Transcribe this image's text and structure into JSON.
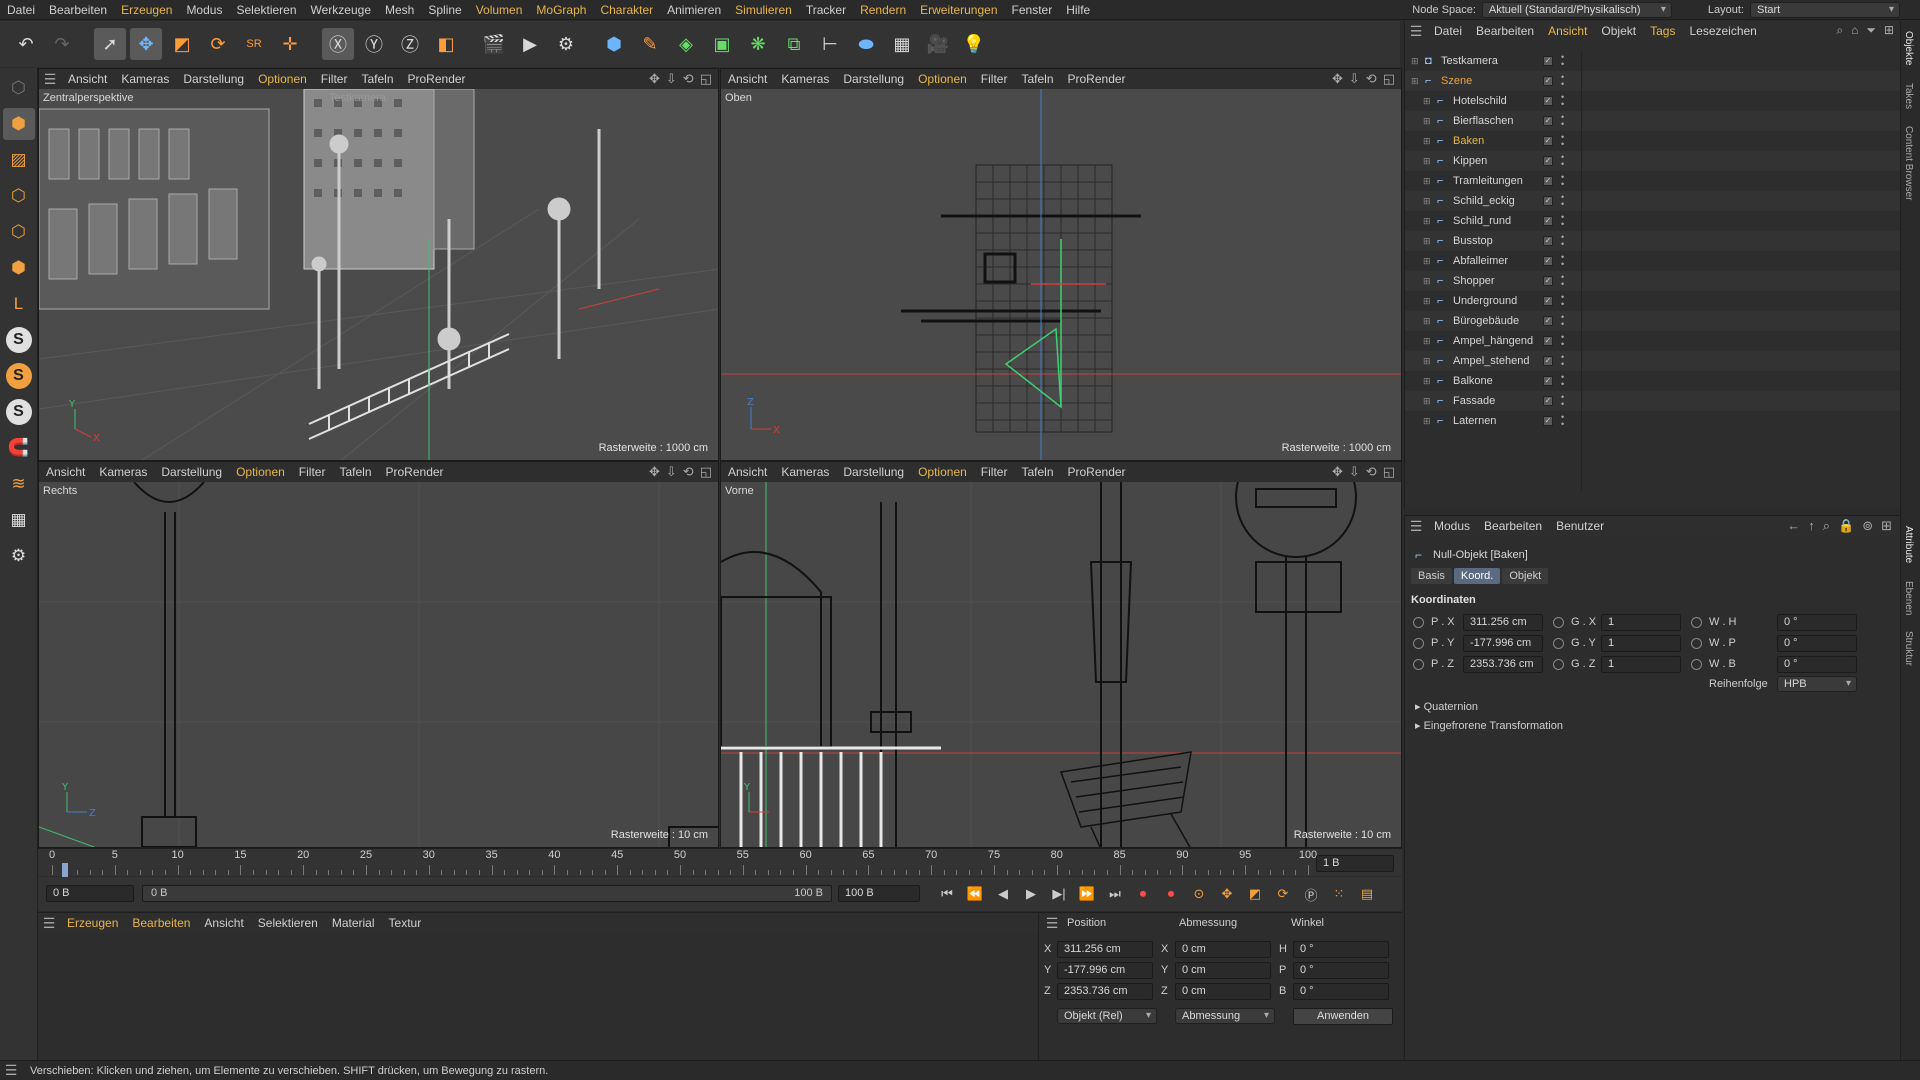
{
  "menubar": {
    "items": [
      "Datei",
      "Bearbeiten",
      "Erzeugen",
      "Modus",
      "Selektieren",
      "Werkzeuge",
      "Mesh",
      "Spline",
      "Volumen",
      "MoGraph",
      "Charakter",
      "Animieren",
      "Simulieren",
      "Tracker",
      "Rendern",
      "Erweiterungen",
      "Fenster",
      "Hilfe"
    ],
    "highlighted": [
      "Erzeugen",
      "Volumen",
      "MoGraph",
      "Charakter",
      "Simulieren",
      "Rendern",
      "Erweiterungen"
    ],
    "node_space_label": "Node Space:",
    "node_space_value": "Aktuell (Standard/Physikalisch)",
    "layout_label": "Layout:",
    "layout_value": "Start"
  },
  "viewports": {
    "menu": [
      "Ansicht",
      "Kameras",
      "Darstellung",
      "Optionen",
      "Filter",
      "Tafeln",
      "ProRender"
    ],
    "top_left": {
      "name": "Zentralperspektive",
      "camera": "Testkamera",
      "grid": "Rasterweite : 1000 cm"
    },
    "top_right": {
      "name": "Oben",
      "grid": "Rasterweite : 1000 cm"
    },
    "bottom_left": {
      "name": "Rechts",
      "grid": "Rasterweite : 10 cm"
    },
    "bottom_right": {
      "name": "Vorne",
      "grid": "Rasterweite : 10 cm"
    }
  },
  "timeline": {
    "ticks": [
      "0",
      "5",
      "10",
      "15",
      "20",
      "25",
      "30",
      "35",
      "40",
      "45",
      "50",
      "55",
      "60",
      "65",
      "70",
      "75",
      "80",
      "85",
      "90",
      "95",
      "100"
    ],
    "current_frame_field": "1 B",
    "start_field": "0 B",
    "range_start": "0 B",
    "range_end": "100 B",
    "end_field": "100 B"
  },
  "material_manager": {
    "menu": [
      "Erzeugen",
      "Bearbeiten",
      "Ansicht",
      "Selektieren",
      "Material",
      "Textur"
    ],
    "highlighted": [
      "Erzeugen",
      "Bearbeiten"
    ]
  },
  "coordinates": {
    "headers": {
      "position": "Position",
      "size": "Abmessung",
      "rotation": "Winkel"
    },
    "rows": [
      {
        "axis": "X",
        "pos": "311.256 cm",
        "size_axis": "X",
        "size": "0 cm",
        "rot_axis": "H",
        "rot": "0 °"
      },
      {
        "axis": "Y",
        "pos": "-177.996 cm",
        "size_axis": "Y",
        "size": "0 cm",
        "rot_axis": "P",
        "rot": "0 °"
      },
      {
        "axis": "Z",
        "pos": "2353.736 cm",
        "size_axis": "Z",
        "size": "0 cm",
        "rot_axis": "B",
        "rot": "0 °"
      }
    ],
    "mode": "Objekt (Rel)",
    "size_mode": "Abmessung",
    "apply": "Anwenden"
  },
  "status": "Verschieben: Klicken und ziehen, um Elemente zu verschieben. SHIFT drücken, um Bewegung zu rastern.",
  "object_manager": {
    "menu": [
      "Datei",
      "Bearbeiten",
      "Ansicht",
      "Objekt",
      "Tags",
      "Lesezeichen"
    ],
    "highlighted": [
      "Ansicht",
      "Tags"
    ],
    "objects": [
      {
        "name": "Testkamera",
        "level": 0,
        "type": "camera"
      },
      {
        "name": "Szene",
        "level": 0,
        "type": "null",
        "color": "orange"
      },
      {
        "name": "Hotelschild",
        "level": 1,
        "type": "null"
      },
      {
        "name": "Bierflaschen",
        "level": 1,
        "type": "null"
      },
      {
        "name": "Baken",
        "level": 1,
        "type": "null",
        "color": "selected"
      },
      {
        "name": "Kippen",
        "level": 1,
        "type": "null"
      },
      {
        "name": "Tramleitungen",
        "level": 1,
        "type": "null"
      },
      {
        "name": "Schild_eckig",
        "level": 1,
        "type": "null"
      },
      {
        "name": "Schild_rund",
        "level": 1,
        "type": "null"
      },
      {
        "name": "Busstop",
        "level": 1,
        "type": "null"
      },
      {
        "name": "Abfalleimer",
        "level": 1,
        "type": "null"
      },
      {
        "name": "Shopper",
        "level": 1,
        "type": "null"
      },
      {
        "name": "Underground",
        "level": 1,
        "type": "null"
      },
      {
        "name": "Bürogebäude",
        "level": 1,
        "type": "null"
      },
      {
        "name": "Ampel_hängend",
        "level": 1,
        "type": "null"
      },
      {
        "name": "Ampel_stehend",
        "level": 1,
        "type": "null"
      },
      {
        "name": "Balkone",
        "level": 1,
        "type": "null"
      },
      {
        "name": "Fassade",
        "level": 1,
        "type": "null"
      },
      {
        "name": "Laternen",
        "level": 1,
        "type": "null"
      }
    ]
  },
  "attribute_manager": {
    "menu": [
      "Modus",
      "Bearbeiten",
      "Benutzer"
    ],
    "title": "Null-Objekt [Baken]",
    "tabs": [
      "Basis",
      "Koord.",
      "Objekt"
    ],
    "active_tab": "Koord.",
    "section": "Koordinaten",
    "rows": [
      {
        "p_label": "P . X",
        "p_val": "311.256 cm",
        "s_label": "G . X",
        "s_val": "1",
        "r_label": "W . H",
        "r_val": "0 °"
      },
      {
        "p_label": "P . Y",
        "p_val": "-177.996 cm",
        "s_label": "G . Y",
        "s_val": "1",
        "r_label": "W . P",
        "r_val": "0 °"
      },
      {
        "p_label": "P . Z",
        "p_val": "2353.736 cm",
        "s_label": "G . Z",
        "s_val": "1",
        "r_label": "W . B",
        "r_val": "0 °"
      }
    ],
    "order_label": "Reihenfolge",
    "order_value": "HPB",
    "collapsed": [
      "Quaternion",
      "Eingefrorene Transformation"
    ]
  },
  "side_tabs": [
    "Objekte",
    "Takes",
    "Content Browser",
    "Attribute",
    "Ebenen",
    "Struktur"
  ],
  "colors": {
    "accent": "#e8b64a",
    "viewport_bg": "#4a4a4a",
    "panel_bg": "#2d2d2d",
    "axis_x": "#d04040",
    "axis_y": "#40c070",
    "axis_z": "#4080d0"
  }
}
